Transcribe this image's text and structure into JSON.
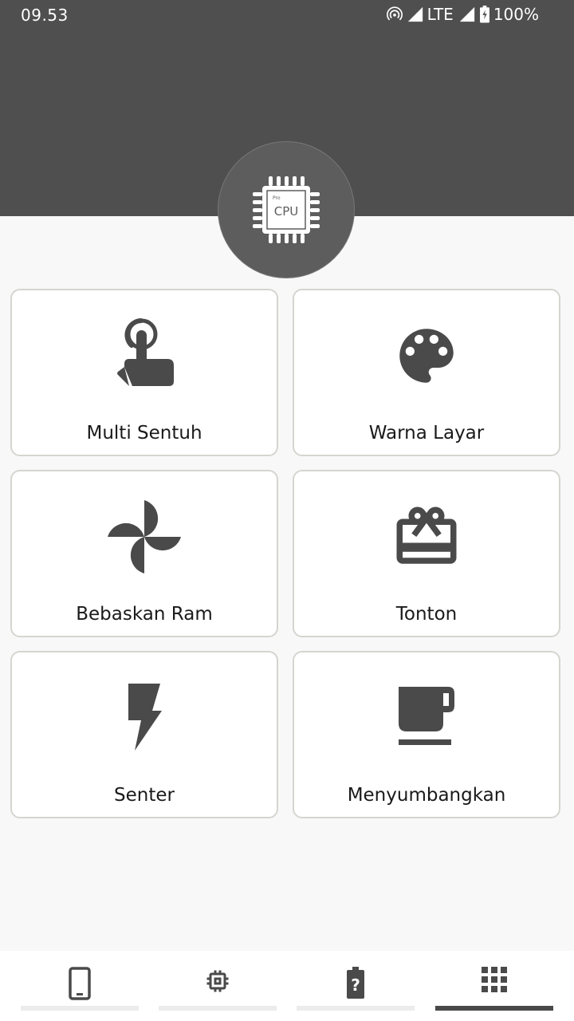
{
  "status_bar": {
    "time": "09.53",
    "network": "LTE",
    "battery": "100%"
  },
  "header": {
    "logo_text": "CPU",
    "logo_small_text": "Pro"
  },
  "tools": [
    {
      "label": "Multi Sentuh",
      "icon": "touch-icon"
    },
    {
      "label": "Warna Layar",
      "icon": "palette-icon"
    },
    {
      "label": "Bebaskan Ram",
      "icon": "pinwheel-icon"
    },
    {
      "label": "Tonton",
      "icon": "gift-card-icon"
    },
    {
      "label": "Senter",
      "icon": "flash-icon"
    },
    {
      "label": "Menyumbangkan",
      "icon": "coffee-icon"
    }
  ],
  "bottom_nav": {
    "items": [
      {
        "icon": "phone-icon",
        "active": false
      },
      {
        "icon": "chip-icon",
        "active": false
      },
      {
        "icon": "battery-unknown-icon",
        "active": false
      },
      {
        "icon": "apps-grid-icon",
        "active": true
      }
    ]
  },
  "colors": {
    "header_bg": "#4f4f4f",
    "icon_color": "#4a4a4a",
    "background": "#f8f8f8",
    "card_border": "#d5d5d0",
    "active_tab": "#4a4a4a"
  }
}
